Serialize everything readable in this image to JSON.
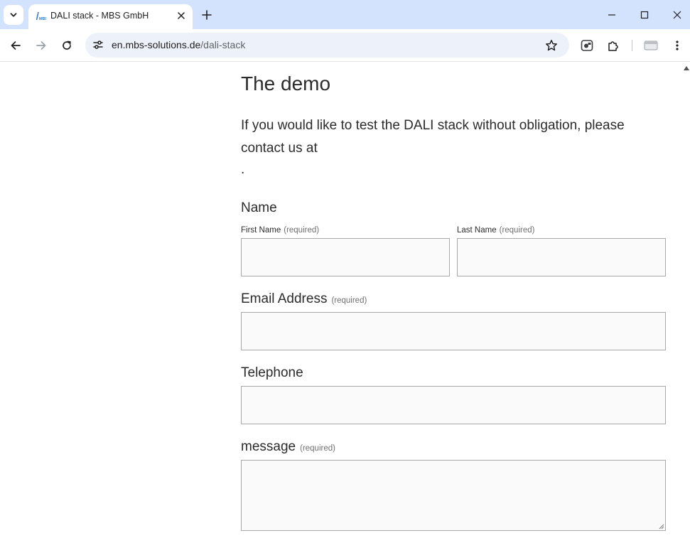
{
  "browser": {
    "tab": {
      "title": "DALI stack - MBS GmbH"
    },
    "url": {
      "host": "en.mbs-solutions.de",
      "path": "/dali-stack"
    }
  },
  "page": {
    "section_title": "The demo",
    "intro": "If you would like to test the DALI stack without obligation, please contact us at",
    "trailing_dot": ".",
    "form": {
      "required_marker": "(required)",
      "name": {
        "label": "Name",
        "first_name_label": "First Name",
        "last_name_label": "Last Name",
        "first_name_value": "",
        "last_name_value": ""
      },
      "email": {
        "label": "Email Address",
        "value": ""
      },
      "telephone": {
        "label": "Telephone",
        "value": ""
      },
      "message": {
        "label": "message",
        "value": ""
      }
    }
  },
  "icons": {
    "tab_search": "chevron-down-icon",
    "favicon": "mbs-logo-icon",
    "tab_close": "close-icon",
    "new_tab": "plus-icon",
    "back": "arrow-left-icon",
    "forward": "arrow-right-icon",
    "reload": "reload-icon",
    "site_info": "tune-icon",
    "bookmark": "star-icon",
    "extension": "puzzle-icon",
    "menu": "kebab-icon"
  },
  "colors": {
    "tab_strip": "#d3e3fd",
    "omnibox": "#edf2fa",
    "input_bg": "#fafafa",
    "input_border": "#a8a8a8"
  }
}
